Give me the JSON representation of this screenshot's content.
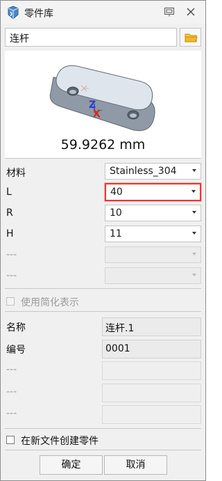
{
  "window": {
    "title": "零件库"
  },
  "part_name": "连杆",
  "preview": {
    "measurement": "59.9262 mm",
    "axis_labels": [
      "Z",
      "X"
    ]
  },
  "params": [
    {
      "label": "材料",
      "value": "Stainless_304",
      "enabled": true,
      "highlighted": false
    },
    {
      "label": "L",
      "value": "40",
      "enabled": true,
      "highlighted": true
    },
    {
      "label": "R",
      "value": "10",
      "enabled": true,
      "highlighted": false
    },
    {
      "label": "H",
      "value": "11",
      "enabled": true,
      "highlighted": false
    },
    {
      "label": "---",
      "value": "",
      "enabled": false,
      "highlighted": false
    },
    {
      "label": "---",
      "value": "",
      "enabled": false,
      "highlighted": false
    }
  ],
  "simplified": {
    "label": "使用简化表示",
    "checked": false,
    "enabled": false
  },
  "info": [
    {
      "label": "名称",
      "value": "连杆.1"
    },
    {
      "label": "编号",
      "value": "0001"
    },
    {
      "label": "---",
      "value": ""
    },
    {
      "label": "---",
      "value": ""
    },
    {
      "label": "---",
      "value": ""
    }
  ],
  "new_file": {
    "label": "在新文件创建零件",
    "checked": false
  },
  "buttons": {
    "ok": "确定",
    "cancel": "取消"
  },
  "colors": {
    "highlight": "#e53935",
    "folder": "#f2b824",
    "axis_z": "#2a3bd6",
    "axis_x": "#d62a2a"
  }
}
